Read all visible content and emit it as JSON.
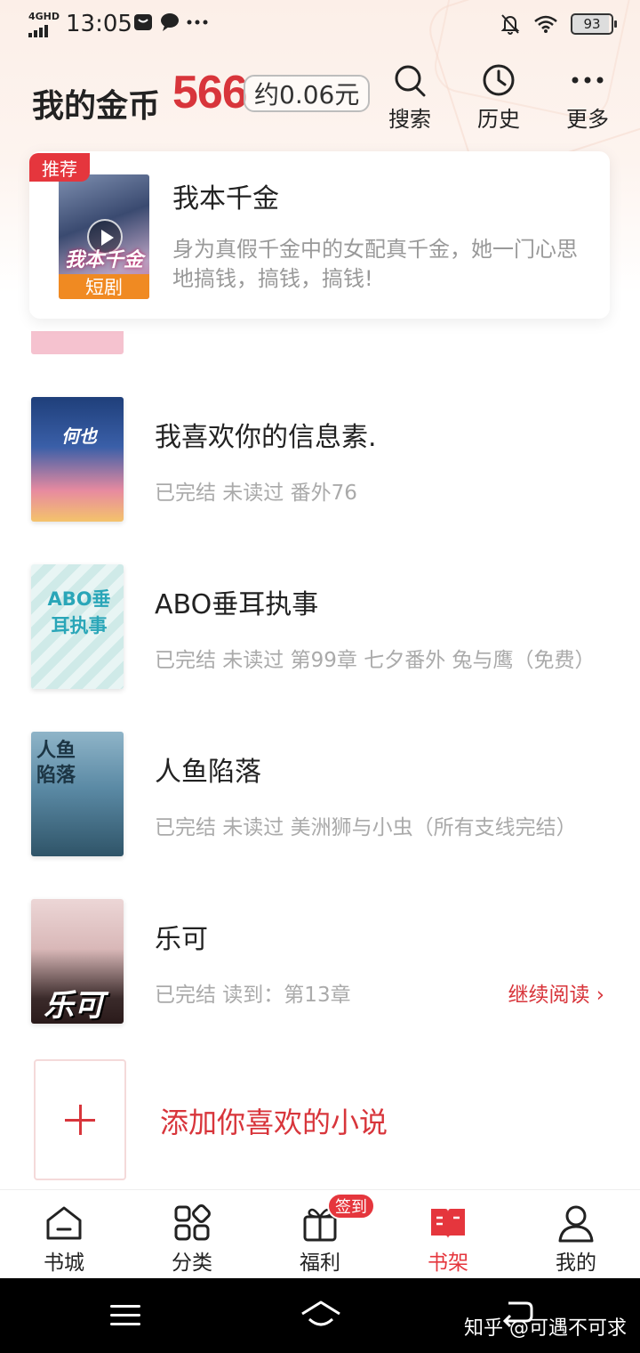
{
  "status_bar": {
    "network": "4GHD",
    "time": "13:05",
    "battery": "93"
  },
  "header": {
    "coins_label": "我的金币",
    "coins_value": "566",
    "coins_approx": "约0.06元",
    "actions": [
      {
        "label": "搜索",
        "icon": "search-icon"
      },
      {
        "label": "历史",
        "icon": "clock-icon"
      },
      {
        "label": "更多",
        "icon": "more-icon"
      }
    ]
  },
  "recommend": {
    "tag": "推荐",
    "title": "我本千金",
    "cover_title": "我本千金",
    "cover_band": "短剧",
    "description": "身为真假千金中的女配真千金，她一门心思地搞钱，搞钱，搞钱!"
  },
  "books": [
    {
      "title": "我喜欢你的信息素.",
      "meta": "已完结 未读过 番外76",
      "cover_text": "何也"
    },
    {
      "title": "ABO垂耳执事",
      "meta": "已完结 未读过 第99章 七夕番外 兔与鹰（免费）",
      "cover_text": "ABO垂耳执事"
    },
    {
      "title": "人鱼陷落",
      "meta": "已完结 未读过 美洲狮与小虫（所有支线完结）",
      "cover_text": "人鱼陷落"
    },
    {
      "title": "乐可",
      "meta": "已完结 读到：第13章",
      "cover_text": "乐可",
      "continue": "继续阅读 ›"
    }
  ],
  "add_book": {
    "label": "添加你喜欢的小说"
  },
  "tabbar": {
    "items": [
      {
        "label": "书城",
        "icon": "home-icon"
      },
      {
        "label": "分类",
        "icon": "category-icon"
      },
      {
        "label": "福利",
        "icon": "gift-icon"
      },
      {
        "label": "书架",
        "icon": "bookshelf-icon",
        "active": true
      },
      {
        "label": "我的",
        "icon": "profile-icon"
      }
    ],
    "sign_badge": "签到"
  },
  "watermark": "知乎 @可遇不可求",
  "colors": {
    "accent": "#e5363d",
    "coin": "#d8353b",
    "muted": "#aaaaaa"
  }
}
